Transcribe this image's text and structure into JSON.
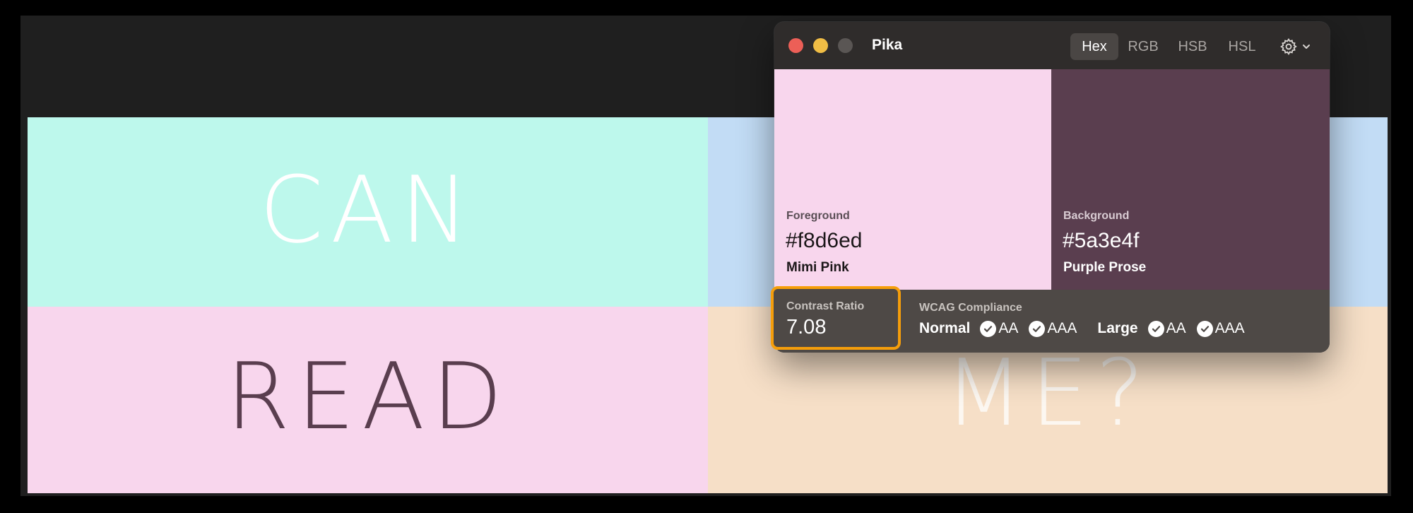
{
  "colors": {
    "mint": "#bdf8ec",
    "light_blue": "#c2dcf5",
    "pink": "#f8d6ed",
    "peach": "#f6dfc7",
    "purple": "#5a3e4f",
    "white": "#ffffff",
    "close": "#ec5f57",
    "minimize": "#f0bd45",
    "zoom_inactive": "#5a5654"
  },
  "canvas": {
    "top_left_word": "CAN",
    "bottom_left_word": "READ",
    "bottom_right_word": "ME?"
  },
  "window": {
    "title": "Pika",
    "formats": [
      "Hex",
      "RGB",
      "HSB",
      "HSL"
    ],
    "active_format": "Hex",
    "settings_icon": "gear-icon",
    "foreground": {
      "label": "Foreground",
      "hex": "#f8d6ed",
      "name": "Mimi Pink"
    },
    "background": {
      "label": "Background",
      "hex": "#5a3e4f",
      "name": "Purple Prose"
    },
    "contrast": {
      "label": "Contrast Ratio",
      "value": "7.08"
    },
    "wcag": {
      "label": "WCAG Compliance",
      "normal_label": "Normal",
      "large_label": "Large",
      "aa": "AA",
      "aaa": "AAA"
    }
  }
}
